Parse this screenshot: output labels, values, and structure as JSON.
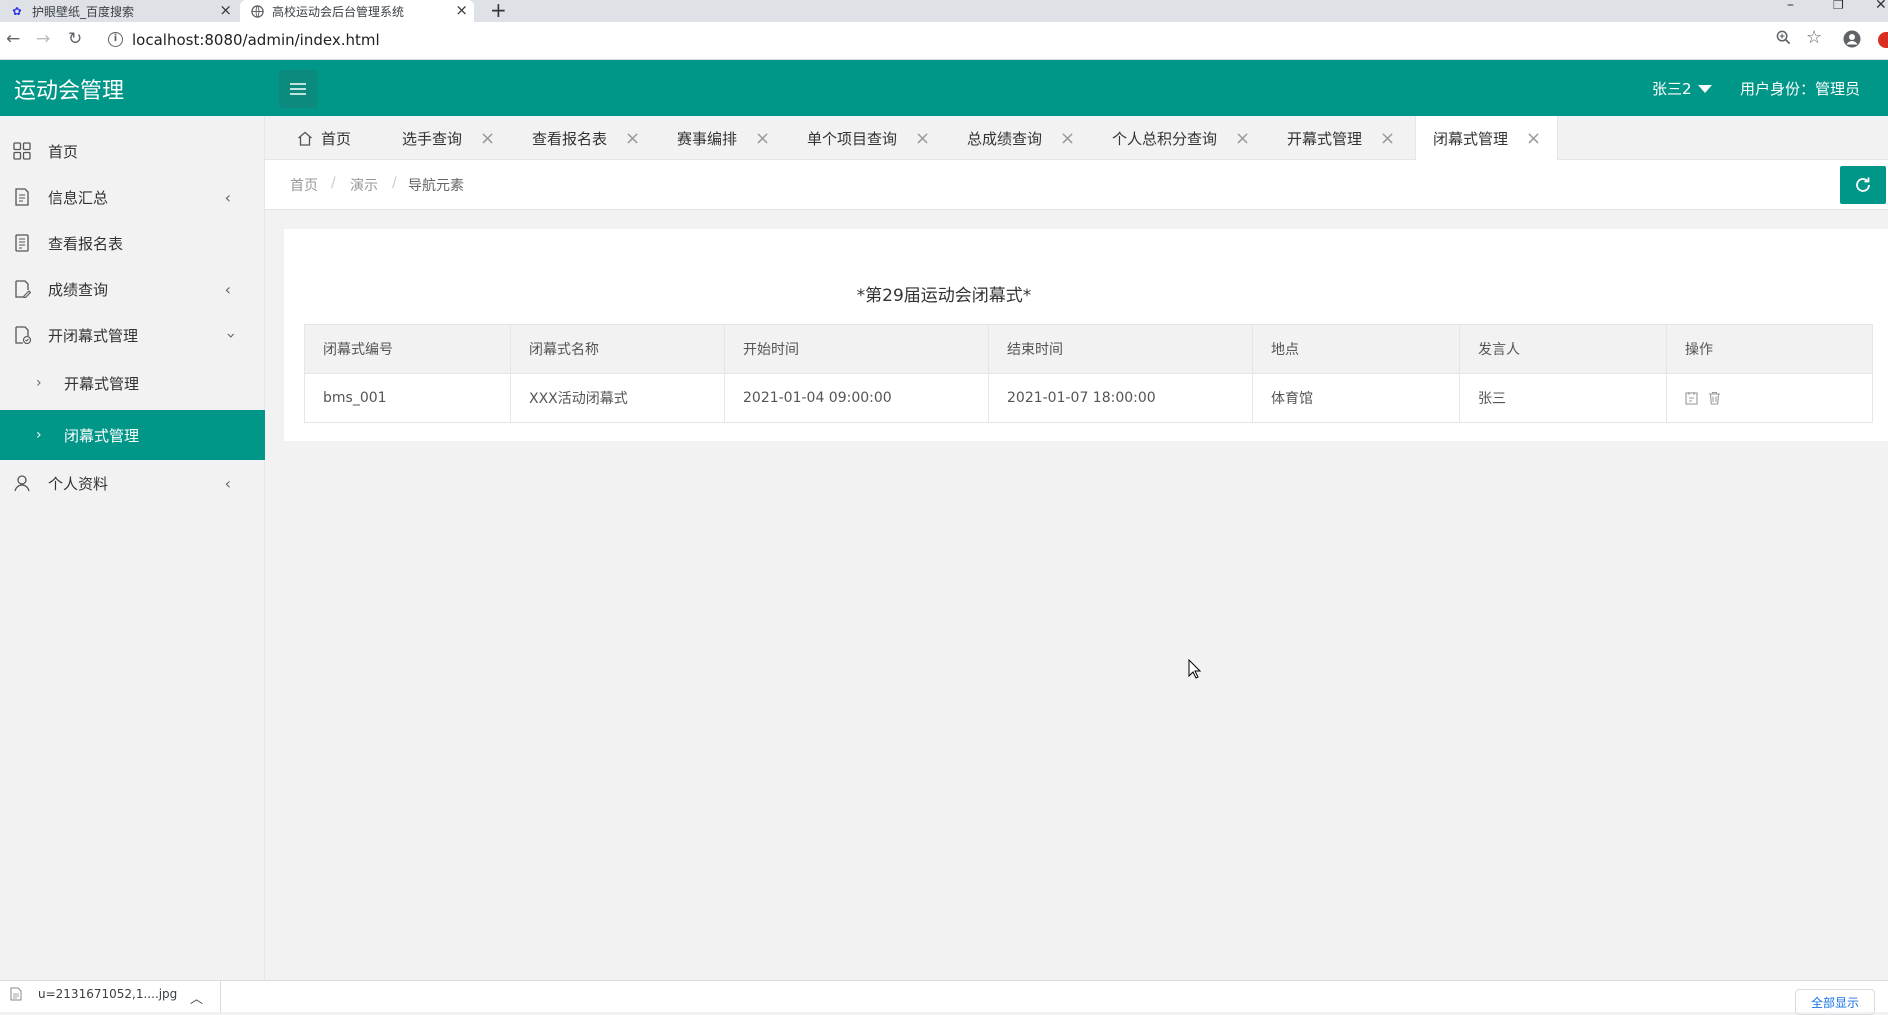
{
  "browser": {
    "tabs": [
      {
        "title": "护眼壁纸_百度搜索",
        "icon": "baidu-paw-icon"
      },
      {
        "title": "高校运动会后台管理系统",
        "icon": "globe-icon"
      }
    ],
    "url": "localhost:8080/admin/index.html"
  },
  "header": {
    "app_title": "运动会管理",
    "user_name": "张三2",
    "user_role": "用户身份：管理员"
  },
  "sidebar": {
    "items": [
      {
        "label": "首页",
        "icon": "grid-icon"
      },
      {
        "label": "信息汇总",
        "icon": "document-icon"
      },
      {
        "label": "查看报名表",
        "icon": "list-icon"
      },
      {
        "label": "成绩查询",
        "icon": "document-edit-icon"
      },
      {
        "label": "开闭幕式管理",
        "icon": "document-check-icon"
      },
      {
        "label": "开幕式管理"
      },
      {
        "label": "闭幕式管理"
      },
      {
        "label": "个人资料",
        "icon": "user-icon"
      }
    ]
  },
  "page_tabs": [
    "首页",
    "选手查询",
    "查看报名表",
    "赛事编排",
    "单个项目查询",
    "总成绩查询",
    "个人总积分查询",
    "开幕式管理",
    "闭幕式管理"
  ],
  "breadcrumb": [
    "首页",
    "演示",
    "导航元素"
  ],
  "main": {
    "title": "*第29届运动会闭幕式*",
    "columns": [
      "闭幕式编号",
      "闭幕式名称",
      "开始时间",
      "结束时间",
      "地点",
      "发言人",
      "操作"
    ],
    "rows": [
      [
        "bms_001",
        "XXX活动闭幕式",
        "2021-01-04 09:00:00",
        "2021-01-07 18:00:00",
        "体育馆",
        "张三"
      ]
    ]
  },
  "download_bar": {
    "file_name": "u=2131671052,1....jpg",
    "show_all": "全部显示"
  },
  "colors": {
    "primary": "#009688",
    "sidebar_bg": "#f2f2f2"
  }
}
